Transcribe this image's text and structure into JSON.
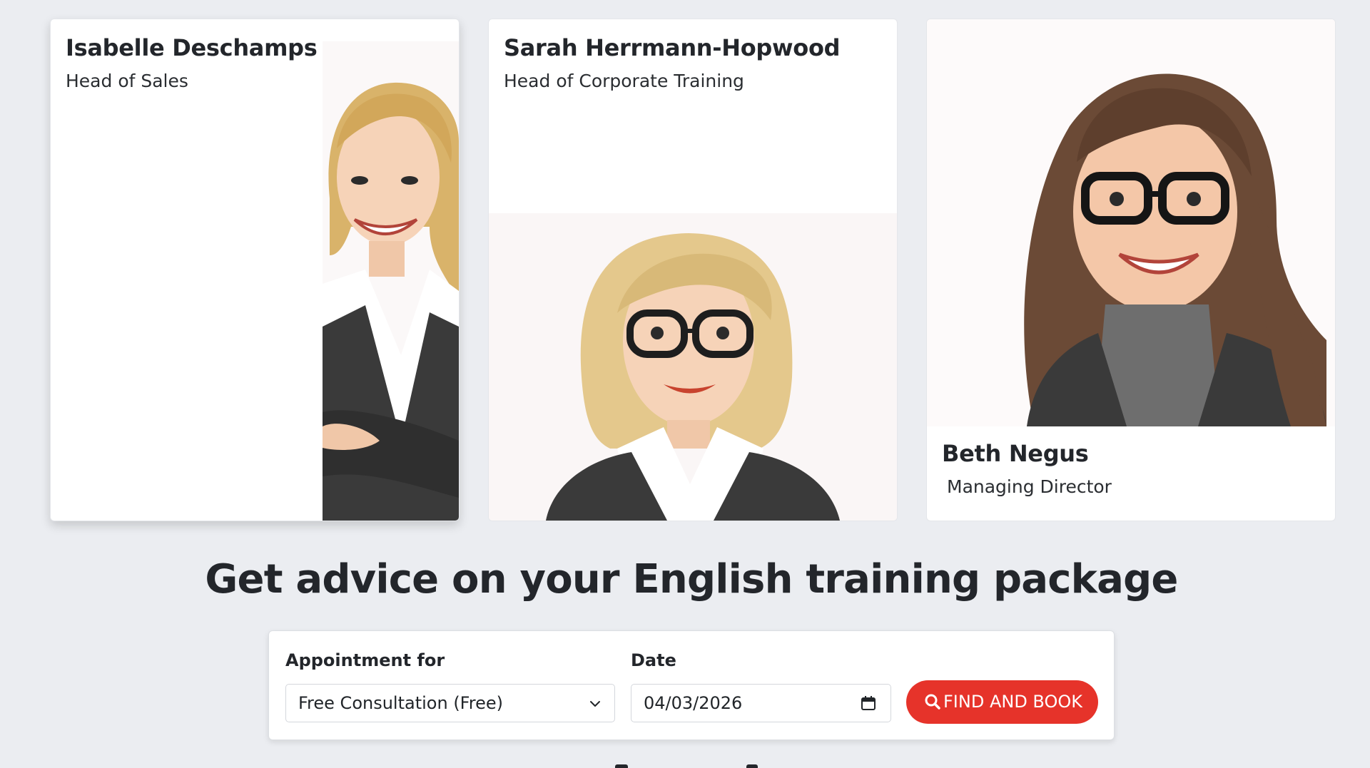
{
  "team": [
    {
      "name": "Isabelle Deschamps",
      "role": "Head of Sales",
      "portrait": "illustrated-portrait-blonde-woman-dark-blazer"
    },
    {
      "name": "Sarah Herrmann-Hopwood",
      "role": "Head of Corporate Training",
      "portrait": "illustrated-portrait-blonde-woman-leopard-glasses"
    },
    {
      "name": "Beth Negus",
      "role": "Managing Director",
      "portrait": "illustrated-portrait-brunette-woman-black-glasses"
    }
  ],
  "booking": {
    "heading": "Get advice on your English training package",
    "appointment_label": "Appointment for",
    "appointment_value": "Free Consultation (Free)",
    "date_label": "Date",
    "date_value": "04/03/2026",
    "button_label": "FIND AND BOOK",
    "icons": {
      "select": "chevron-down-icon",
      "date": "calendar-icon",
      "button": "search-icon"
    }
  },
  "colors": {
    "page_background": "#ebedf1",
    "accent_button": "#e6332a",
    "heading_text": "#23262b"
  }
}
